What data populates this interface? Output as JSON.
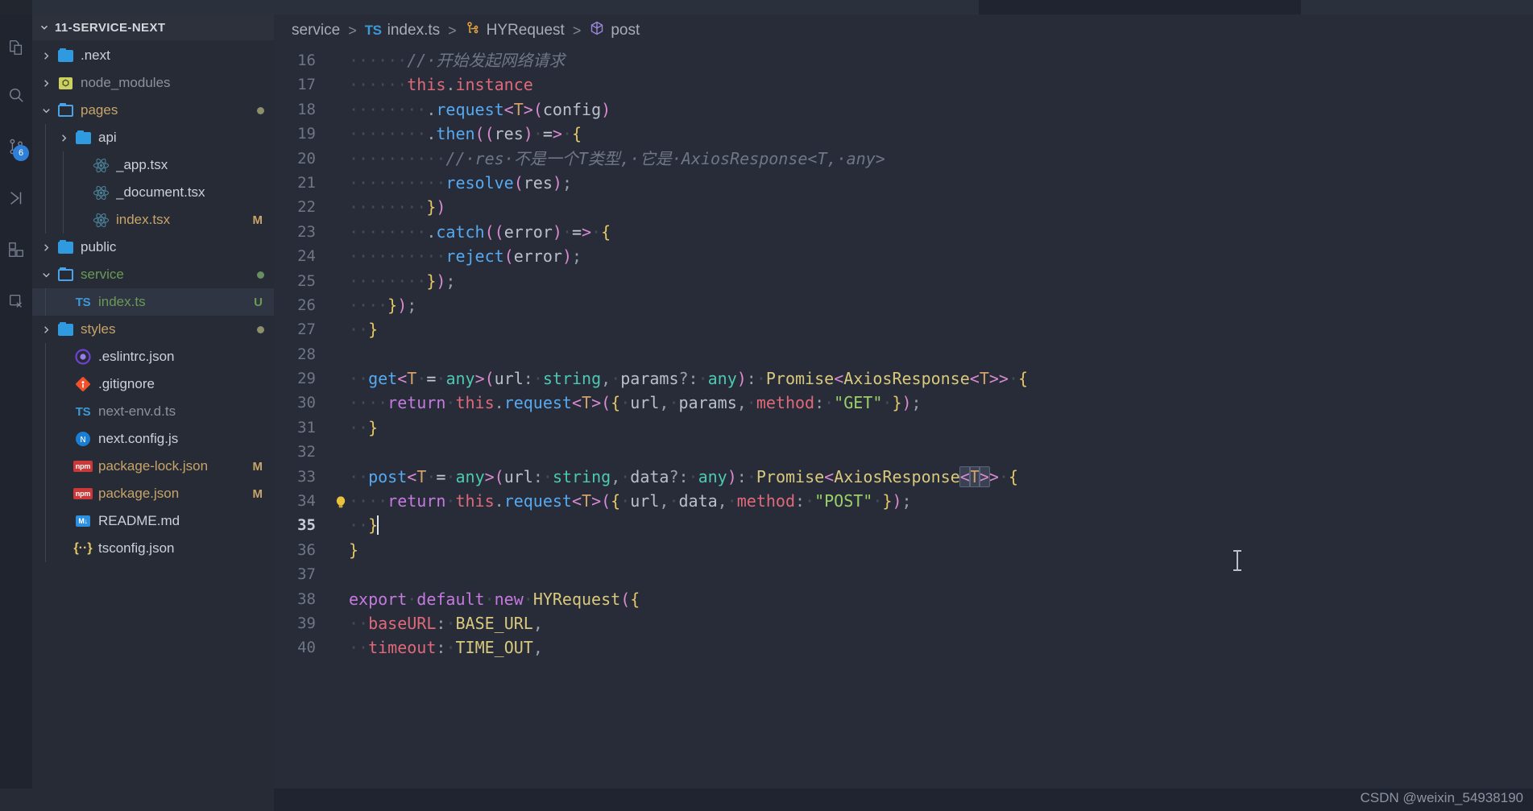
{
  "window": {
    "title": "11-SERVICE-NEXT"
  },
  "activity_bar": {
    "items": [
      {
        "name": "explorer",
        "icon": "files-icon"
      },
      {
        "name": "search",
        "icon": "search-icon"
      },
      {
        "name": "source-control",
        "icon": "source-control-icon",
        "badge": "6"
      },
      {
        "name": "run-debug",
        "icon": "run-debug-icon"
      },
      {
        "name": "extensions",
        "icon": "extensions-icon"
      },
      {
        "name": "testing",
        "icon": "beaker-icon"
      }
    ]
  },
  "sidebar": {
    "header_label": "11-SERVICE-NEXT",
    "tree": [
      {
        "label": ".next",
        "type": "folder",
        "icon": "folder-closed-icon",
        "depth": 1,
        "expanded": false,
        "deco": "",
        "deco_color": ""
      },
      {
        "label": "node_modules",
        "type": "folder",
        "icon": "node-modules-icon",
        "depth": 1,
        "expanded": false,
        "deco": "",
        "deco_color": "",
        "dim": true
      },
      {
        "label": "pages",
        "type": "folder",
        "icon": "folder-open-icon",
        "depth": 1,
        "expanded": true,
        "deco": "",
        "deco_color": "",
        "dot": "#8d8f6a"
      },
      {
        "label": "api",
        "type": "folder",
        "icon": "folder-closed-icon",
        "depth": 2,
        "expanded": false,
        "deco": "",
        "deco_color": ""
      },
      {
        "label": "_app.tsx",
        "type": "file",
        "icon": "react-icon",
        "depth": 3,
        "deco": "",
        "deco_color": ""
      },
      {
        "label": "_document.tsx",
        "type": "file",
        "icon": "react-icon",
        "depth": 3,
        "deco": "",
        "deco_color": ""
      },
      {
        "label": "index.tsx",
        "type": "file",
        "icon": "react-icon",
        "depth": 3,
        "deco": "M",
        "deco_color": "#c8a46a",
        "modified": true
      },
      {
        "label": "public",
        "type": "folder",
        "icon": "folder-closed-icon",
        "depth": 1,
        "expanded": false,
        "deco": "",
        "deco_color": ""
      },
      {
        "label": "service",
        "type": "folder",
        "icon": "folder-open-icon",
        "depth": 1,
        "expanded": true,
        "deco": "",
        "deco_color": "",
        "dot": "#6a8f5f",
        "new": true
      },
      {
        "label": "index.ts",
        "type": "file",
        "icon": "ts-icon",
        "depth": 2,
        "deco": "U",
        "deco_color": "#6a9a55",
        "selected": true,
        "untracked": true
      },
      {
        "label": "styles",
        "type": "folder",
        "icon": "folder-closed-icon",
        "depth": 1,
        "expanded": false,
        "deco": "",
        "deco_color": "",
        "dot": "#8d8f6a"
      },
      {
        "label": ".eslintrc.json",
        "type": "file",
        "icon": "eslint-icon",
        "depth": 2,
        "deco": "",
        "deco_color": ""
      },
      {
        "label": ".gitignore",
        "type": "file",
        "icon": "git-icon",
        "depth": 2,
        "deco": "",
        "deco_color": ""
      },
      {
        "label": "next-env.d.ts",
        "type": "file",
        "icon": "ts-icon",
        "depth": 2,
        "deco": "",
        "deco_color": "",
        "dim": true
      },
      {
        "label": "next.config.js",
        "type": "file",
        "icon": "next-icon",
        "depth": 2,
        "deco": "",
        "deco_color": ""
      },
      {
        "label": "package-lock.json",
        "type": "file",
        "icon": "npm-icon",
        "depth": 2,
        "deco": "M",
        "deco_color": "#c8a46a",
        "modified": true
      },
      {
        "label": "package.json",
        "type": "file",
        "icon": "npm-icon",
        "depth": 2,
        "deco": "M",
        "deco_color": "#c8a46a",
        "modified": true
      },
      {
        "label": "README.md",
        "type": "file",
        "icon": "markdown-icon",
        "depth": 2,
        "deco": "",
        "deco_color": ""
      },
      {
        "label": "tsconfig.json",
        "type": "file",
        "icon": "json-icon",
        "depth": 2,
        "deco": "",
        "deco_color": ""
      }
    ]
  },
  "breadcrumb": {
    "items": [
      {
        "label": "service",
        "icon": ""
      },
      {
        "label": "index.ts",
        "icon": "ts-icon"
      },
      {
        "label": "HYRequest",
        "icon": "class-icon"
      },
      {
        "label": "post",
        "icon": "method-icon"
      }
    ],
    "separator": ">"
  },
  "editor": {
    "language": "typescript",
    "first_visible_line": 16,
    "last_visible_line": 40,
    "cursor_line": 35,
    "lines": [
      {
        "n": 16,
        "indent_guides": 3,
        "scope": true,
        "text": "      // 开始发起网络请求"
      },
      {
        "n": 17,
        "indent_guides": 3,
        "scope": true,
        "text": "      this.instance"
      },
      {
        "n": 18,
        "indent_guides": 4,
        "scope": true,
        "text": "        .request<T>(config)"
      },
      {
        "n": 19,
        "indent_guides": 4,
        "scope": true,
        "text": "        .then((res) => {"
      },
      {
        "n": 20,
        "indent_guides": 5,
        "scope": true,
        "text": "          // res 不是一个T类型, 它是 AxiosResponse<T, any>"
      },
      {
        "n": 21,
        "indent_guides": 5,
        "scope": true,
        "text": "          resolve(res);"
      },
      {
        "n": 22,
        "indent_guides": 4,
        "scope": true,
        "text": "        })"
      },
      {
        "n": 23,
        "indent_guides": 4,
        "scope": true,
        "text": "        .catch((error) => {"
      },
      {
        "n": 24,
        "indent_guides": 5,
        "scope": true,
        "text": "          reject(error);"
      },
      {
        "n": 25,
        "indent_guides": 4,
        "scope": true,
        "text": "        });"
      },
      {
        "n": 26,
        "indent_guides": 3,
        "scope": true,
        "text": "    });"
      },
      {
        "n": 27,
        "indent_guides": 2,
        "scope": true,
        "text": "  }"
      },
      {
        "n": 28,
        "indent_guides": 0,
        "scope": true,
        "text": ""
      },
      {
        "n": 29,
        "indent_guides": 1,
        "scope": true,
        "text": "  get<T = any>(url: string, params?: any): Promise<AxiosResponse<T>> {"
      },
      {
        "n": 30,
        "indent_guides": 2,
        "scope": true,
        "text": "    return this.request<T>({ url, params, method: \"GET\" });"
      },
      {
        "n": 31,
        "indent_guides": 1,
        "scope": true,
        "text": "  }"
      },
      {
        "n": 32,
        "indent_guides": 0,
        "scope": true,
        "text": ""
      },
      {
        "n": 33,
        "indent_guides": 1,
        "scope": true,
        "text": "  post<T = any>(url: string, data?: any): Promise<AxiosResponse<T>> {"
      },
      {
        "n": 34,
        "indent_guides": 2,
        "scope": true,
        "text": "    return this.request<T>({ url, data, method: \"POST\" });",
        "lightbulb": true
      },
      {
        "n": 35,
        "indent_guides": 1,
        "scope": true,
        "text": "  }",
        "cursor": true,
        "current": true
      },
      {
        "n": 36,
        "indent_guides": 0,
        "scope": false,
        "text": "}"
      },
      {
        "n": 37,
        "indent_guides": 0,
        "scope": false,
        "text": ""
      },
      {
        "n": 38,
        "indent_guides": 0,
        "scope": false,
        "text": "export default new HYRequest({"
      },
      {
        "n": 39,
        "indent_guides": 1,
        "scope": false,
        "text": "  baseURL: BASE_URL,"
      },
      {
        "n": 40,
        "indent_guides": 1,
        "scope": false,
        "text": "  timeout: TIME_OUT,"
      }
    ]
  },
  "watermark": "CSDN @weixin_54938190",
  "colors": {
    "editor_bg": "#272c38",
    "sidebar_bg": "#262b36",
    "activitybar_bg": "#20242e",
    "accent_blue": "#2f9ae0",
    "scope_yellow": "#d6b321",
    "badge_blue": "#2f7fd8",
    "modified": "#c8a46a",
    "untracked": "#6a9a55"
  }
}
